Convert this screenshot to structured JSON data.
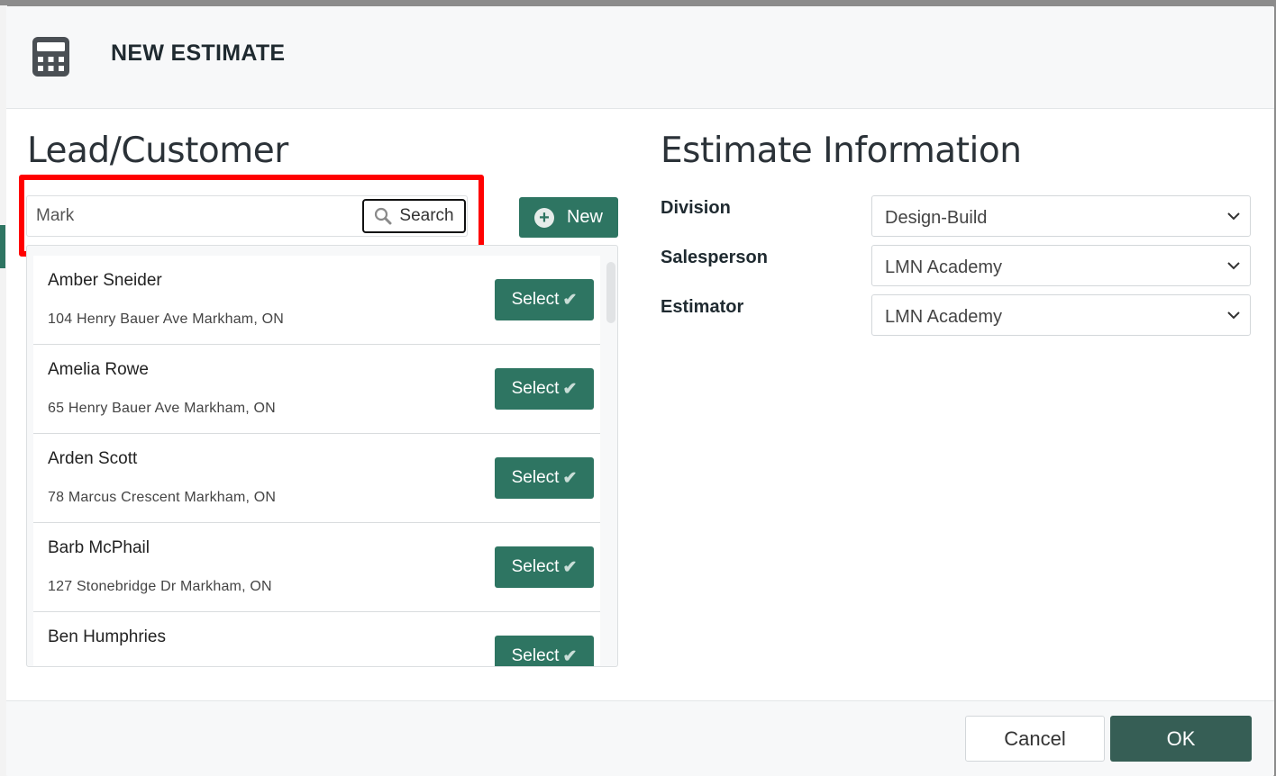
{
  "modal": {
    "title": "NEW ESTIMATE",
    "icon": "calculator-icon"
  },
  "lead_customer": {
    "section_title": "Lead/Customer",
    "search": {
      "value": "Mark",
      "button_label": "Search",
      "icon": "search-icon"
    },
    "new_button_label": "New",
    "select_label": "Select",
    "items": [
      {
        "name": "Amber Sneider",
        "address": "104 Henry Bauer Ave Markham, ON"
      },
      {
        "name": "Amelia Rowe",
        "address": "65 Henry Bauer Ave Markham, ON"
      },
      {
        "name": "Arden Scott",
        "address": "78 Marcus Crescent Markham, ON"
      },
      {
        "name": "Barb McPhail",
        "address": "127 Stonebridge Dr Markham, ON"
      },
      {
        "name": "Ben Humphries",
        "address": ""
      }
    ]
  },
  "estimate_info": {
    "section_title": "Estimate Information",
    "fields": [
      {
        "label": "Division",
        "value": "Design-Build"
      },
      {
        "label": "Salesperson",
        "value": "LMN Academy"
      },
      {
        "label": "Estimator",
        "value": "LMN Academy"
      }
    ]
  },
  "footer": {
    "cancel_label": "Cancel",
    "ok_label": "OK"
  },
  "colors": {
    "primary_green": "#2e7562",
    "ok_dark_green": "#365e55",
    "highlight_red": "#ff0000"
  }
}
